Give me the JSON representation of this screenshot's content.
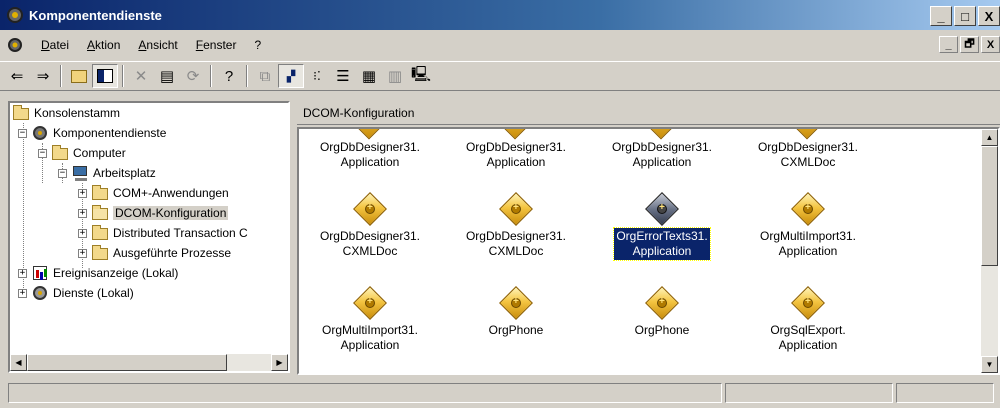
{
  "window": {
    "title": "Komponentendienste",
    "buttons": {
      "minimize": "_",
      "maximize": "□",
      "close": "X"
    }
  },
  "menubar": {
    "items": [
      "Datei",
      "Aktion",
      "Ansicht",
      "Fenster",
      "?"
    ],
    "mdi_buttons": {
      "minimize": "_",
      "restore": "🗗",
      "close": "X"
    }
  },
  "toolbar": {
    "back": "⇐",
    "forward": "⇒"
  },
  "tree": {
    "items": [
      {
        "label": "Konsolenstamm"
      },
      {
        "label": "Komponentendienste"
      },
      {
        "label": "Computer"
      },
      {
        "label": "Arbeitsplatz"
      },
      {
        "label": "COM+-Anwendungen"
      },
      {
        "label": "DCOM-Konfiguration"
      },
      {
        "label": "Distributed Transaction C"
      },
      {
        "label": "Ausgeführte Prozesse"
      },
      {
        "label": "Ereignisanzeige (Lokal)"
      },
      {
        "label": "Dienste (Lokal)"
      }
    ]
  },
  "content": {
    "header": "DCOM-Konfiguration",
    "row1": [
      {
        "line1": "OrgDbDesigner31.",
        "line2": "Application"
      },
      {
        "line1": "OrgDbDesigner31.",
        "line2": "Application"
      },
      {
        "line1": "OrgDbDesigner31.",
        "line2": "Application"
      },
      {
        "line1": "OrgDbDesigner31.",
        "line2": "CXMLDoc"
      }
    ],
    "row2": [
      {
        "line1": "OrgDbDesigner31.",
        "line2": "CXMLDoc"
      },
      {
        "line1": "OrgDbDesigner31.",
        "line2": "CXMLDoc"
      },
      {
        "line1": "OrgErrorTexts31.",
        "line2": "Application"
      },
      {
        "line1": "OrgMultiImport31.",
        "line2": "Application"
      }
    ],
    "row3": [
      {
        "line1": "OrgMultiImport31.",
        "line2": "Application"
      },
      {
        "line1": "OrgPhone",
        "line2": ""
      },
      {
        "line1": "OrgPhone",
        "line2": ""
      },
      {
        "line1": "OrgSqlExport.",
        "line2": "Application"
      }
    ]
  },
  "colors": {
    "selection": "#0a246a",
    "face": "#d4d0c8"
  }
}
